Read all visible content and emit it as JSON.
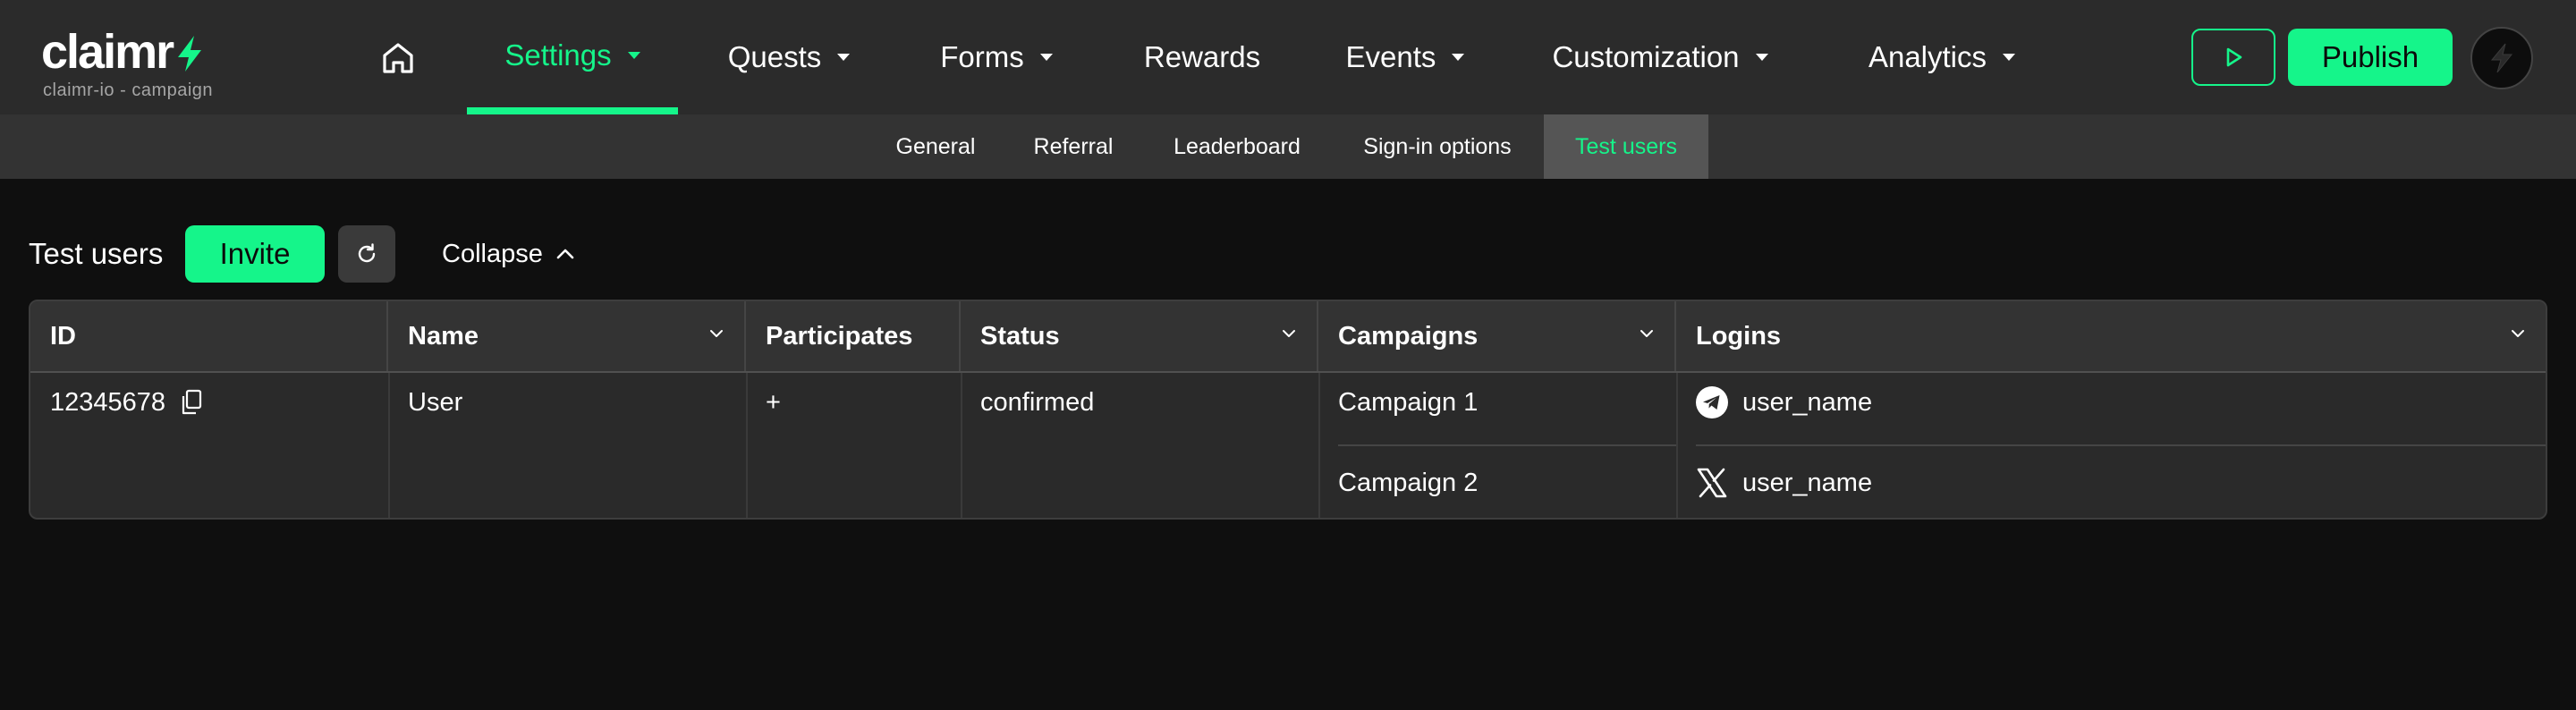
{
  "app": {
    "logo_text": "claimr",
    "logo_subtitle": "claimr-io - campaign",
    "accent_color": "#15f58a"
  },
  "nav": {
    "home_icon": "home-icon",
    "items": [
      {
        "label": "Settings",
        "has_dropdown": true,
        "active": true
      },
      {
        "label": "Quests",
        "has_dropdown": true,
        "active": false
      },
      {
        "label": "Forms",
        "has_dropdown": true,
        "active": false
      },
      {
        "label": "Rewards",
        "has_dropdown": false,
        "active": false
      },
      {
        "label": "Events",
        "has_dropdown": true,
        "active": false
      },
      {
        "label": "Customization",
        "has_dropdown": true,
        "active": false
      },
      {
        "label": "Analytics",
        "has_dropdown": true,
        "active": false
      }
    ],
    "preview_icon": "play-icon",
    "publish_label": "Publish",
    "avatar_icon": "bolt-icon"
  },
  "subnav": {
    "items": [
      {
        "label": "General",
        "active": false
      },
      {
        "label": "Referral",
        "active": false
      },
      {
        "label": "Leaderboard",
        "active": false
      },
      {
        "label": "Sign-in options",
        "active": false
      },
      {
        "label": "Test users",
        "active": true
      }
    ]
  },
  "toolbar": {
    "title": "Test users",
    "invite_label": "Invite",
    "refresh_icon": "refresh-icon",
    "collapse_label": "Collapse"
  },
  "table": {
    "columns": [
      {
        "label": "ID",
        "sortable": false
      },
      {
        "label": "Name",
        "sortable": true
      },
      {
        "label": "Participates",
        "sortable": false
      },
      {
        "label": "Status",
        "sortable": true
      },
      {
        "label": "Campaigns",
        "sortable": true
      },
      {
        "label": "Logins",
        "sortable": true
      }
    ],
    "rows": [
      {
        "id": "12345678",
        "name": "User",
        "participates": "+",
        "status": "confirmed",
        "campaigns": [
          "Campaign 1",
          "Campaign 2"
        ],
        "logins": [
          {
            "icon": "telegram-icon",
            "username": "user_name"
          },
          {
            "icon": "x-icon",
            "username": "user_name"
          }
        ]
      }
    ]
  }
}
